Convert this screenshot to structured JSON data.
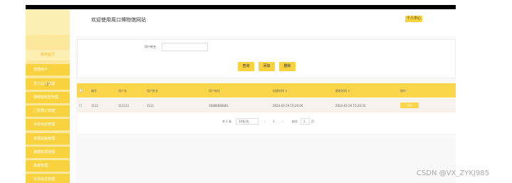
{
  "sidebar": {
    "logo_text": "· —",
    "user_text": "— · —",
    "home_label": "系统首页",
    "items": [
      {
        "label": "管理用户"
      },
      {
        "label": "员工信息管理"
      },
      {
        "label": "博物馆类型管理"
      },
      {
        "label": "门票预订管理"
      },
      {
        "label": "论坐论坐管理"
      },
      {
        "label": "资源设备管理"
      },
      {
        "label": "数据资源管理"
      },
      {
        "label": "系统管理"
      },
      {
        "label": "订单信息管理"
      }
    ]
  },
  "header": {
    "title": "欢迎使用周口博物馆网站",
    "personal_center": "个人中心"
  },
  "search": {
    "label": "用户姓名",
    "value": "",
    "query_button": "查询",
    "add_button": "添加",
    "delete_button": "删除"
  },
  "table": {
    "columns": [
      "编号",
      "用户名",
      "用户姓名",
      "用户电话",
      "创建时间 ↕",
      "更新时间 ↕",
      "操作"
    ],
    "rows": [
      {
        "id": "1111",
        "username": "111111",
        "name": "1111",
        "phone": "18888888881",
        "created": "2024-03-29 15:20:06",
        "updated": "2024-03-29 15:20:33",
        "action": "详情"
      }
    ]
  },
  "pagination": {
    "total": "共 1 条",
    "page_size": "10条/页",
    "prev": "‹",
    "current_page": "1",
    "next": "›",
    "goto_label": "前往",
    "goto_value": "1",
    "page_suffix": "页"
  },
  "watermark": "CSDN @VX_ZYKJ985",
  "colors": {
    "accent": "#f9d240",
    "sidebar_bg": "#fde79a",
    "topbar": "#000000"
  }
}
